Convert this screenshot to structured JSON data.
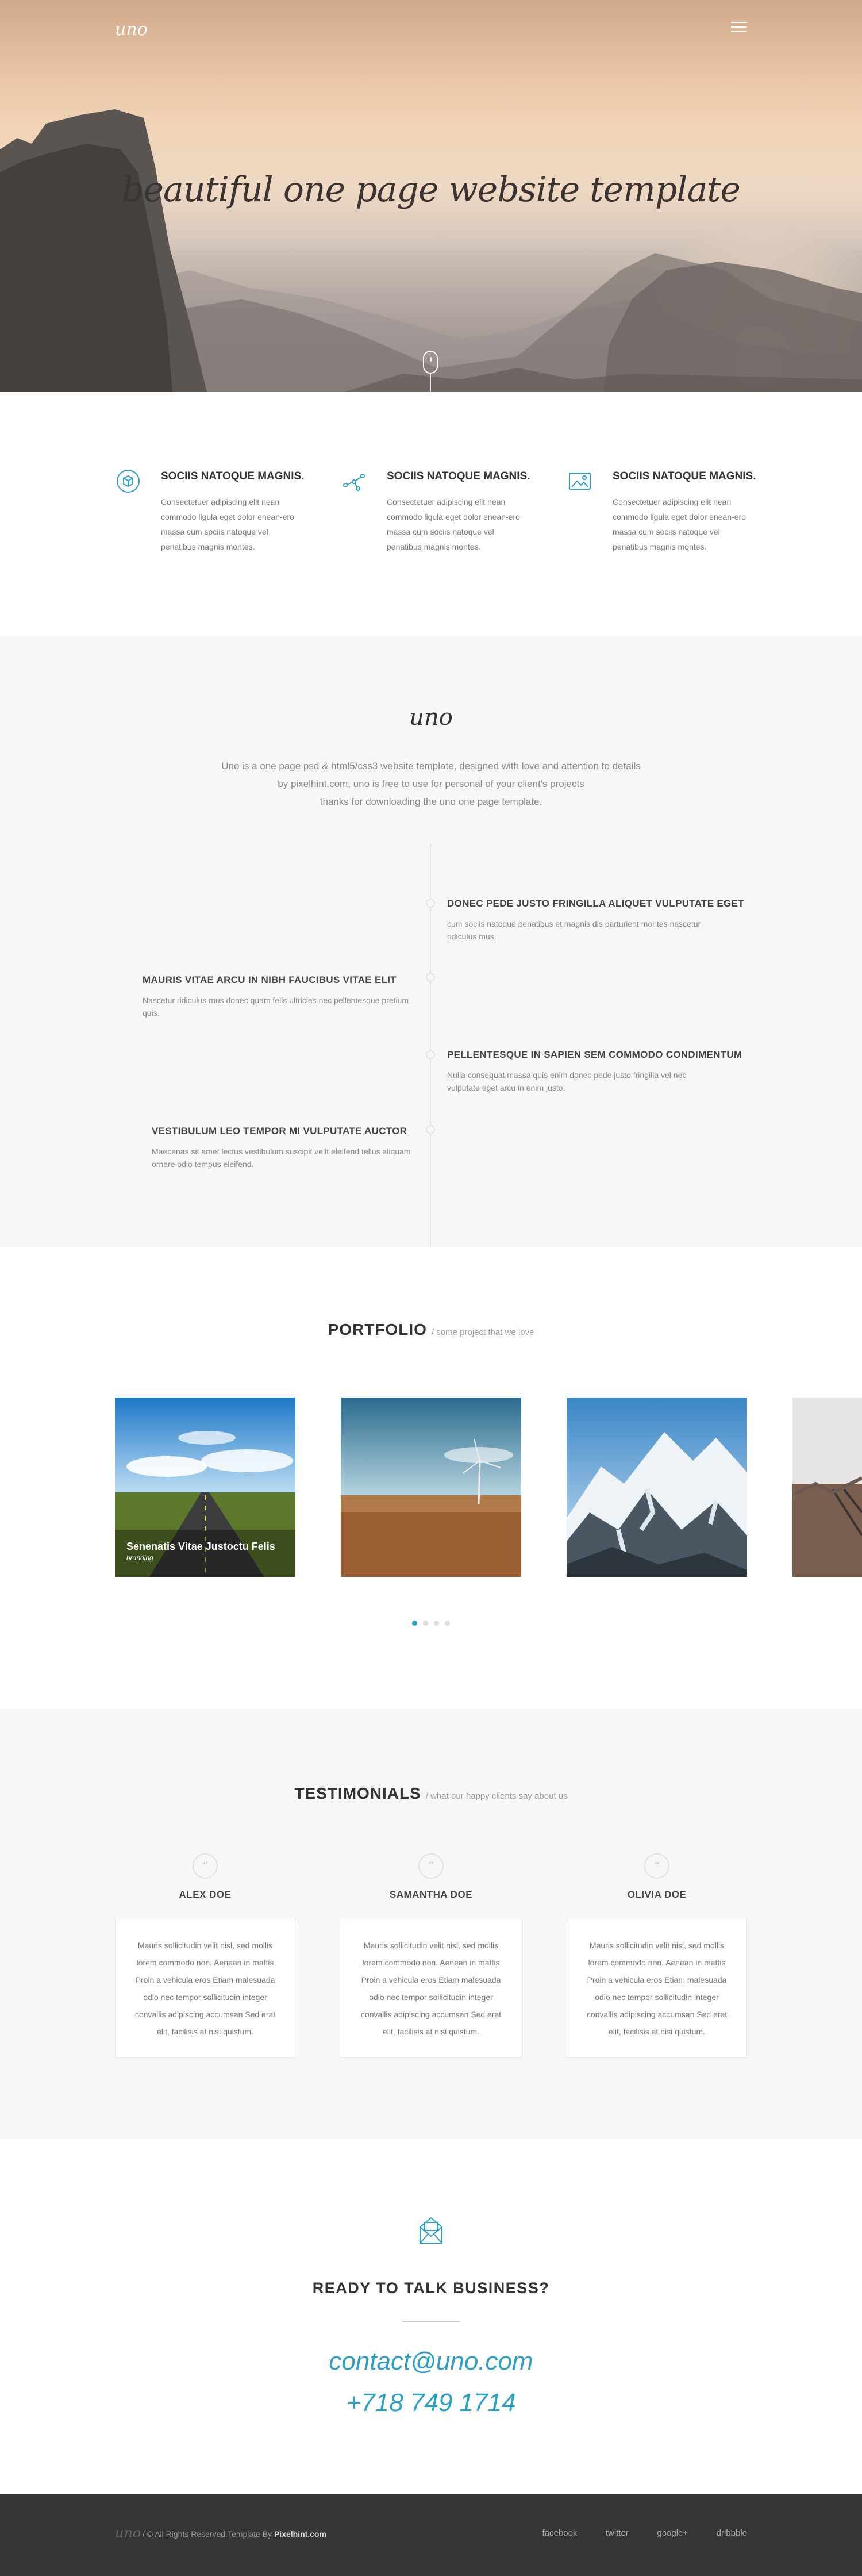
{
  "hero": {
    "logo": "uno",
    "title": "beautiful one page website template"
  },
  "features": [
    {
      "icon": "cube-icon",
      "title": "SOCIIS NATOQUE MAGNIS.",
      "text": "Consectetuer adipiscing elit nean commodo ligula eget dolor enean-ero massa cum sociis natoque vel penatibus magnis montes."
    },
    {
      "icon": "network-icon",
      "title": "SOCIIS NATOQUE MAGNIS.",
      "text": "Consectetuer adipiscing elit nean commodo ligula eget dolor enean-ero massa cum sociis natoque vel penatibus magnis montes."
    },
    {
      "icon": "image-icon",
      "title": "SOCIIS NATOQUE MAGNIS.",
      "text": "Consectetuer adipiscing elit nean commodo ligula eget dolor enean-ero massa cum sociis natoque vel penatibus magnis montes."
    }
  ],
  "about": {
    "logo": "uno",
    "lines": [
      "Uno is a one page psd & html5/css3 website template, designed with love and attention to details",
      "by pixelhint.com, uno is free to use for personal of your client's projects",
      "thanks for downloading the uno one page template."
    ],
    "timeline": [
      {
        "title": "DONEC PEDE JUSTO FRINGILLA ALIQUET VULPUTATE EGET",
        "text": "cum sociis natoque penatibus et magnis dis parturient montes nascetur ridiculus mus."
      },
      {
        "title": "MAURIS VITAE ARCU IN NIBH FAUCIBUS VITAE ELIT",
        "text": "Nascetur ridiculus mus donec quam felis ultricies nec pellentesque pretium quis."
      },
      {
        "title": "PELLENTESQUE IN SAPIEN SEM COMMODO CONDIMENTUM",
        "text": "Nulla consequat massa quis enim donec pede justo fringilla vel nec vulputate eget arcu in enim justo."
      },
      {
        "title": "VESTIBULUM LEO TEMPOR MI VULPUTATE AUCTOR",
        "text": "Maecenas sit amet lectus vestibulum suscipit velit eleifend tellus aliquam ornare odio tempus eleifend."
      }
    ]
  },
  "portfolio": {
    "title": "PORTFOLIO",
    "subtitle": "/ some project that we love",
    "item_title": "Senenatis Vitae Justoctu Felis",
    "item_category": "branding"
  },
  "testimonials": {
    "title": "TESTIMONIALS",
    "subtitle": "/ what our happy clients say about us",
    "items": [
      {
        "name": "ALEX DOE",
        "text": "Mauris sollicitudin velit nisl, sed mollis lorem commodo non. Aenean in mattis Proin a vehicula eros Etiam malesuada odio nec tempor sollicitudin integer convallis adipiscing accumsan Sed erat elit, facilisis at nisi quistum."
      },
      {
        "name": "SAMANTHA DOE",
        "text": "Mauris sollicitudin velit nisl, sed mollis lorem commodo non. Aenean in mattis Proin a vehicula eros Etiam malesuada odio nec tempor sollicitudin integer convallis adipiscing accumsan Sed erat elit, facilisis at nisi quistum."
      },
      {
        "name": "OLIVIA DOE",
        "text": "Mauris sollicitudin velit nisl, sed mollis lorem commodo non. Aenean in mattis Proin a vehicula eros Etiam malesuada odio nec tempor sollicitudin integer convallis adipiscing accumsan Sed erat elit, facilisis at nisi quistum."
      }
    ]
  },
  "contact": {
    "heading": "READY TO TALK BUSINESS?",
    "email": "contact@uno.com",
    "phone": "+718 749 1714"
  },
  "footer": {
    "logo": "uno",
    "copyright": "/ © All Rights Reserved.Template By",
    "brand": "Pixelhint.com",
    "links": [
      "facebook",
      "twitter",
      "google+",
      "dribbble"
    ]
  },
  "colors": {
    "accent": "#2aa0c7",
    "footer_bg": "#353535",
    "section_alt": "#f7f7f7"
  }
}
